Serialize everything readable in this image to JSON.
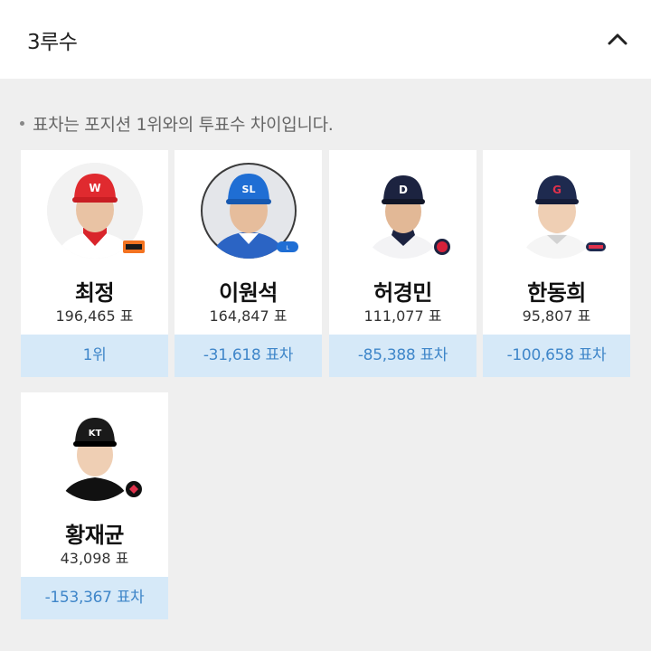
{
  "header": {
    "title": "3루수",
    "collapse_icon": "chevron-up-icon"
  },
  "notice": "표차는 포지션 1위와의 투표수 차이입니다.",
  "players": [
    {
      "name": "최정",
      "votes": "196,465 표",
      "diff": "1위",
      "team_logo": "eagles-logo",
      "cap_color": "#e02a2f",
      "jersey_color": "#ffffff"
    },
    {
      "name": "이원석",
      "votes": "164,847 표",
      "diff": "-31,618 표차",
      "team_logo": "lions-logo",
      "cap_color": "#1f6ed4",
      "jersey_color": "#2b64c4"
    },
    {
      "name": "허경민",
      "votes": "111,077 표",
      "diff": "-85,388 표차",
      "team_logo": "bears-logo",
      "cap_color": "#1c2340",
      "jersey_color": "#f3f3f5"
    },
    {
      "name": "한동희",
      "votes": "95,807 표",
      "diff": "-100,658 표차",
      "team_logo": "giants-logo",
      "cap_color": "#1e2a4f",
      "jersey_color": "#f5f5f5"
    },
    {
      "name": "황재균",
      "votes": "43,098 표",
      "diff": "-153,367 표차",
      "team_logo": "wiz-logo",
      "cap_color": "#1a1a1a",
      "jersey_color": "#111111"
    }
  ]
}
